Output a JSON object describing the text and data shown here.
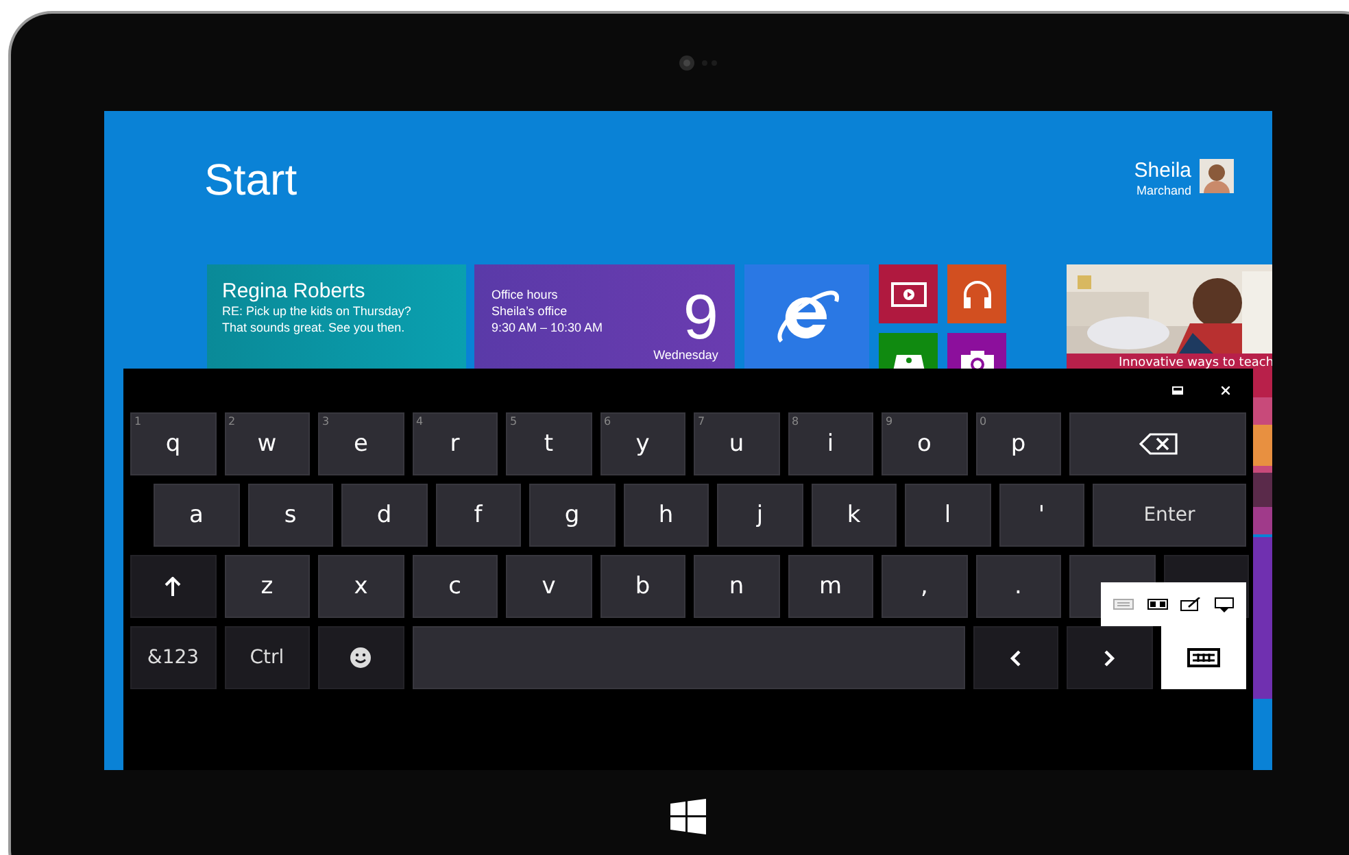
{
  "start_screen": {
    "title": "Start",
    "user": {
      "first_name": "Sheila",
      "last_name": "Marchand"
    },
    "tiles": [
      {
        "kind": "mail",
        "name": "Regina Roberts",
        "lines": [
          "RE: Pick up the kids on Thursday?",
          "That sounds great. See you then."
        ]
      },
      {
        "kind": "calendar",
        "lines": [
          "Office hours",
          "Sheila’s office",
          "9:30 AM – 10:30 AM"
        ],
        "day": "9",
        "weekday": "Wednesday"
      },
      {
        "kind": "browser"
      },
      {
        "kind": "small_group"
      },
      {
        "kind": "news",
        "caption": "Innovative ways to teach"
      }
    ]
  },
  "keyboard": {
    "rows": [
      [
        {
          "kind": "letter",
          "label": "q",
          "hint": "1"
        },
        {
          "kind": "letter",
          "label": "w",
          "hint": "2"
        },
        {
          "kind": "letter",
          "label": "e",
          "hint": "3"
        },
        {
          "kind": "letter",
          "label": "r",
          "hint": "4"
        },
        {
          "kind": "letter",
          "label": "t",
          "hint": "5"
        },
        {
          "kind": "letter",
          "label": "y",
          "hint": "6"
        },
        {
          "kind": "letter",
          "label": "u",
          "hint": "7"
        },
        {
          "kind": "letter",
          "label": "i",
          "hint": "8"
        },
        {
          "kind": "letter",
          "label": "o",
          "hint": "9"
        },
        {
          "kind": "letter",
          "label": "p",
          "hint": "0"
        },
        {
          "kind": "backspace"
        }
      ],
      [
        {
          "kind": "letter",
          "label": "a"
        },
        {
          "kind": "letter",
          "label": "s"
        },
        {
          "kind": "letter",
          "label": "d"
        },
        {
          "kind": "letter",
          "label": "f"
        },
        {
          "kind": "letter",
          "label": "g"
        },
        {
          "kind": "letter",
          "label": "h"
        },
        {
          "kind": "letter",
          "label": "j"
        },
        {
          "kind": "letter",
          "label": "k"
        },
        {
          "kind": "letter",
          "label": "l"
        },
        {
          "kind": "letter",
          "label": "'"
        },
        {
          "kind": "enter",
          "label": "Enter"
        }
      ],
      [
        {
          "kind": "shift"
        },
        {
          "kind": "letter",
          "label": "z"
        },
        {
          "kind": "letter",
          "label": "x"
        },
        {
          "kind": "letter",
          "label": "c"
        },
        {
          "kind": "letter",
          "label": "v"
        },
        {
          "kind": "letter",
          "label": "b"
        },
        {
          "kind": "letter",
          "label": "n"
        },
        {
          "kind": "letter",
          "label": "m"
        },
        {
          "kind": "letter",
          "label": ","
        },
        {
          "kind": "letter",
          "label": "."
        },
        {
          "kind": "covered"
        },
        {
          "kind": "covered_dark"
        }
      ],
      [
        {
          "kind": "function",
          "label": "&123"
        },
        {
          "kind": "function",
          "label": "Ctrl"
        },
        {
          "kind": "emoji"
        },
        {
          "kind": "space"
        },
        {
          "kind": "left"
        },
        {
          "kind": "right"
        },
        {
          "kind": "layout",
          "expanded": true
        }
      ]
    ]
  }
}
